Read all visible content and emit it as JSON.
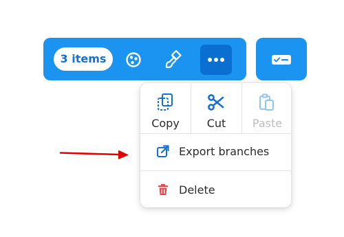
{
  "toolbar": {
    "count_label": "3 items",
    "buttons": [
      {
        "icon": "shapes-icon"
      },
      {
        "icon": "paint-brush-icon"
      },
      {
        "icon": "more-dots-icon",
        "active": true
      }
    ],
    "side_button": {
      "icon": "card-check-icon"
    }
  },
  "menu": {
    "actions": [
      {
        "label": "Copy",
        "icon": "copy-icon",
        "enabled": true
      },
      {
        "label": "Cut",
        "icon": "scissors-icon",
        "enabled": true
      },
      {
        "label": "Paste",
        "icon": "clipboard-icon",
        "enabled": false
      }
    ],
    "export_label": "Export branches",
    "delete_label": "Delete"
  },
  "colors": {
    "toolbar_blue": "#1b93f0",
    "active_button": "#0a6fd0",
    "icon_blue": "#1670d2",
    "delete_red": "#e5484d",
    "annotation_arrow": "#e10000"
  }
}
